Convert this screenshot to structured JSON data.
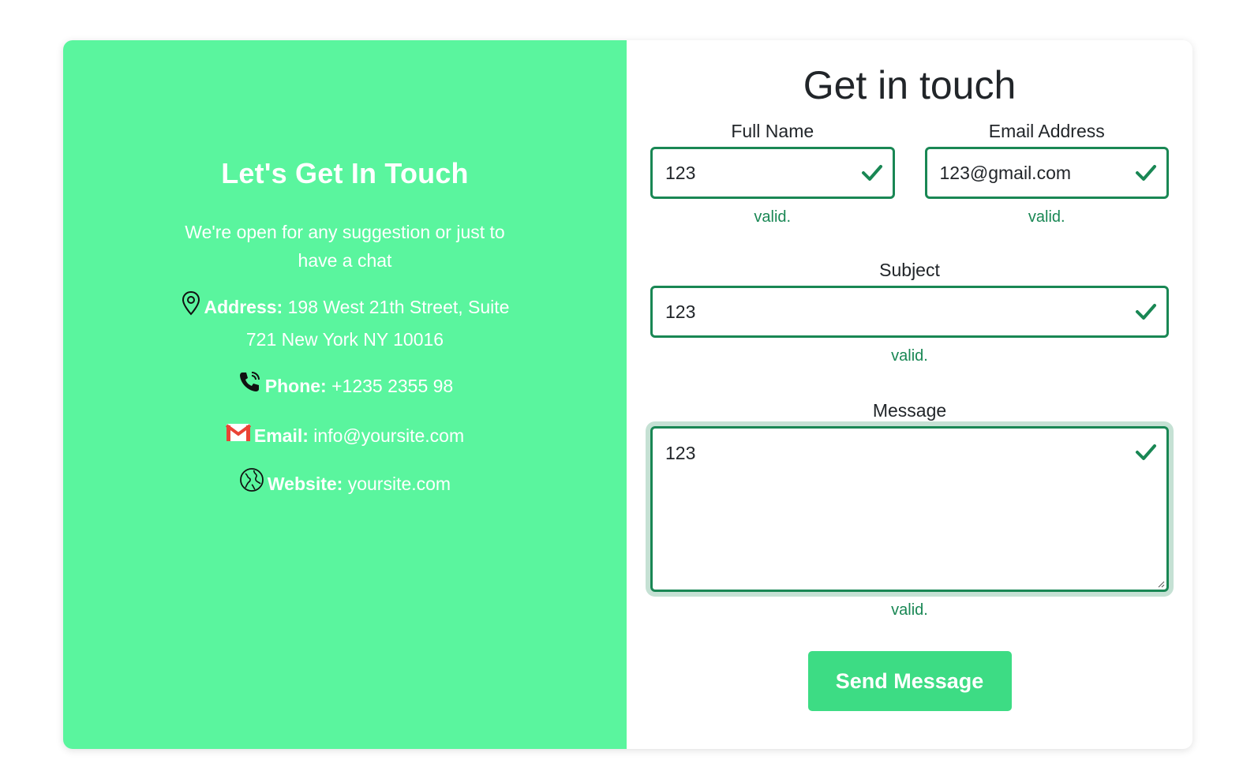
{
  "contact_panel": {
    "title": "Let's Get In Touch",
    "tagline": "We're open for any suggestion or just to have a chat",
    "address_label": "Address:",
    "address_value": "198 West 21th Street, Suite 721 New York NY 10016",
    "phone_label": "Phone:",
    "phone_value": "+1235 2355 98",
    "email_label": "Email:",
    "email_value": "info@yoursite.com",
    "website_label": "Website:",
    "website_value": "yoursite.com",
    "icons": [
      "location-pin-icon",
      "phone-icon",
      "gmail-icon",
      "globe-icon"
    ]
  },
  "form": {
    "title": "Get in touch",
    "full_name": {
      "label": "Full Name",
      "value": "123",
      "feedback": "valid."
    },
    "email": {
      "label": "Email Address",
      "value": "123@gmail.com",
      "feedback": "valid."
    },
    "subject": {
      "label": "Subject",
      "value": "123",
      "feedback": "valid."
    },
    "message": {
      "label": "Message",
      "value": "123",
      "feedback": "valid."
    },
    "submit_label": "Send Message"
  },
  "colors": {
    "panel_bg": "#5af59e",
    "valid_green": "#198754",
    "button_bg": "#3ddc84",
    "text_dark": "#212529"
  }
}
